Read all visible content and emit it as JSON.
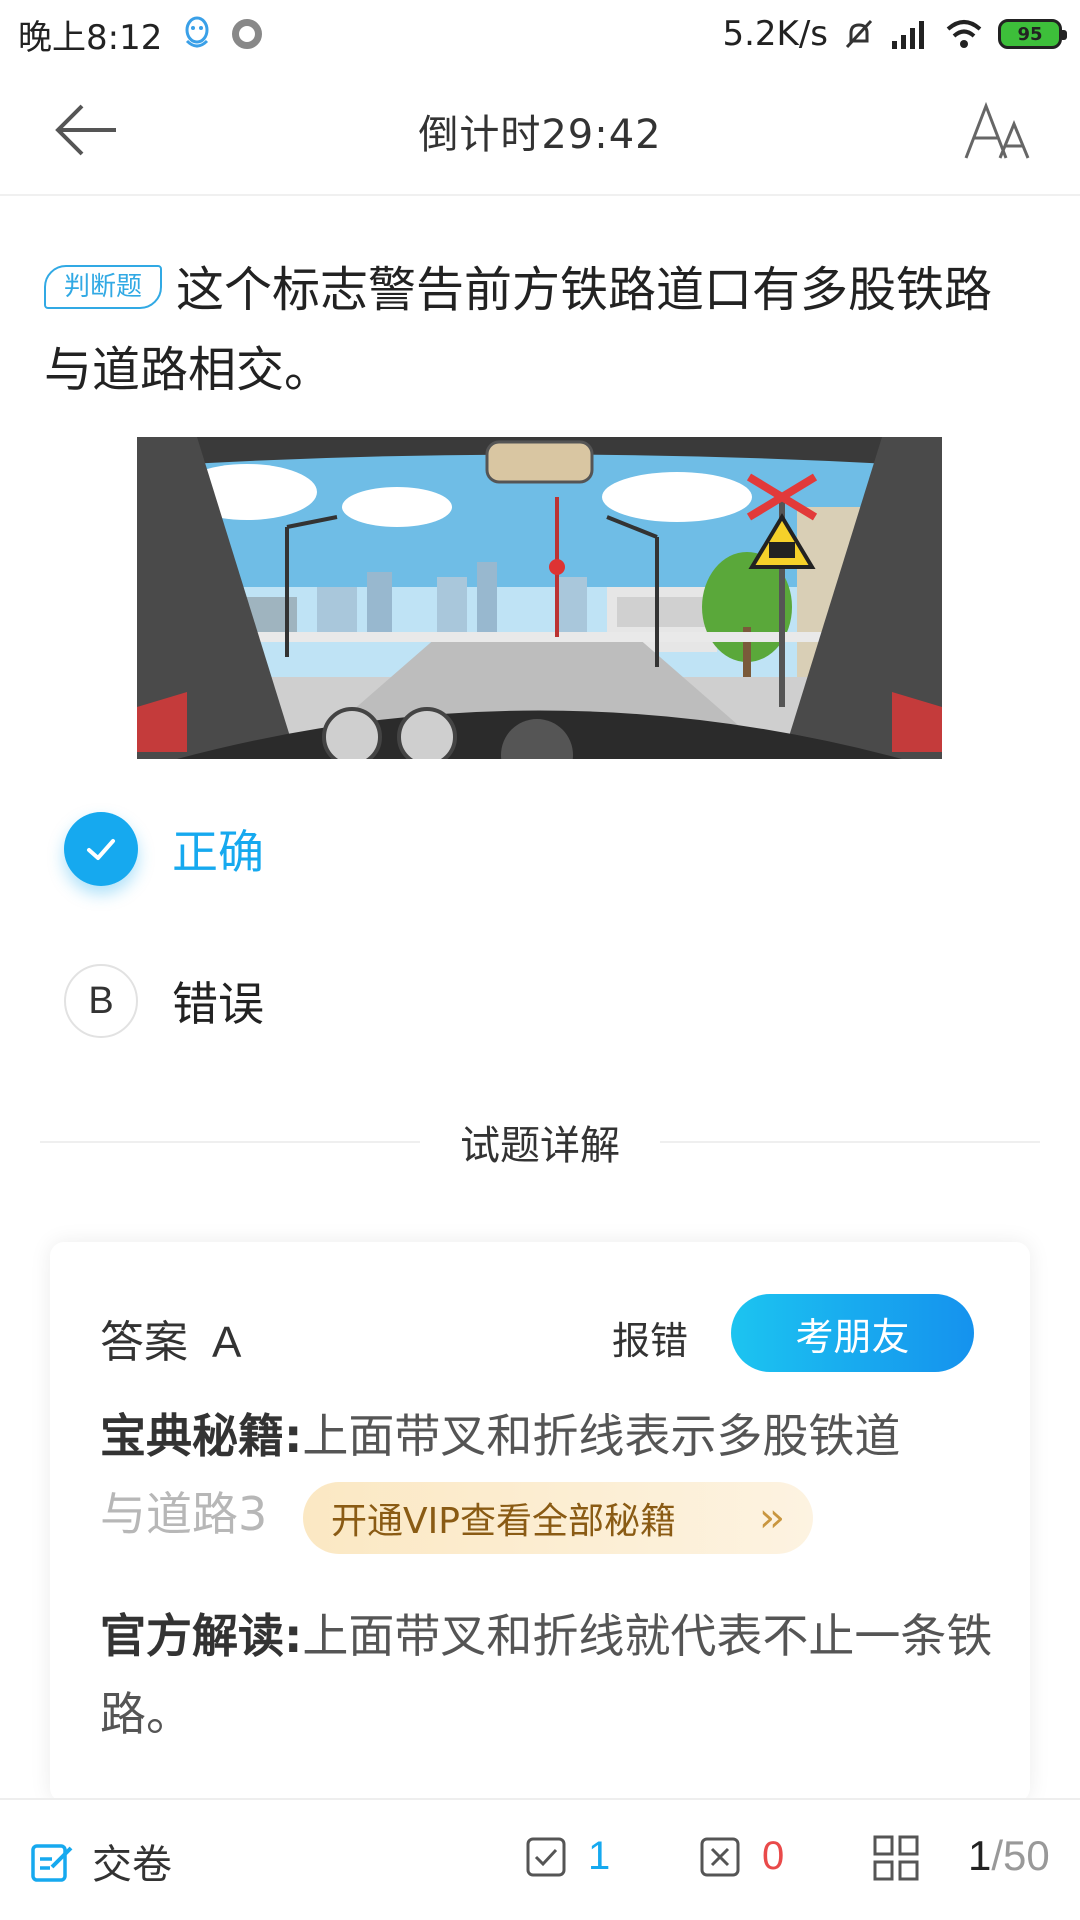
{
  "status_bar": {
    "time": "晚上8:12",
    "speed": "5.2K/s",
    "battery": "95"
  },
  "header": {
    "title": "倒计时29:42"
  },
  "question": {
    "type_badge": "判断题",
    "text": "这个标志警告前方铁路道口有多股铁路与道路相交。"
  },
  "options": [
    {
      "label": "正确",
      "selected": true
    },
    {
      "letter": "B",
      "label": "错误",
      "selected": false
    }
  ],
  "explanation": {
    "section_title": "试题详解",
    "answer_label": "答案",
    "answer_value": "A",
    "report_label": "报错",
    "friend_label": "考朋友",
    "secret_label": "宝典秘籍:",
    "secret_visible": "上面带叉和折线表示多股铁道",
    "secret_faded": "与道路3",
    "vip_label": "开通VIP查看全部秘籍",
    "official_label": "官方解读:",
    "official_text": "上面带叉和折线就代表不止一条铁路。"
  },
  "bottom_bar": {
    "submit_label": "交卷",
    "correct_count": "1",
    "wrong_count": "0",
    "current_page": "1",
    "total_pages": "/50"
  },
  "colors": {
    "accent": "#16a9ef",
    "wrong": "#e94a4a",
    "vip_text": "#8a5b14"
  }
}
